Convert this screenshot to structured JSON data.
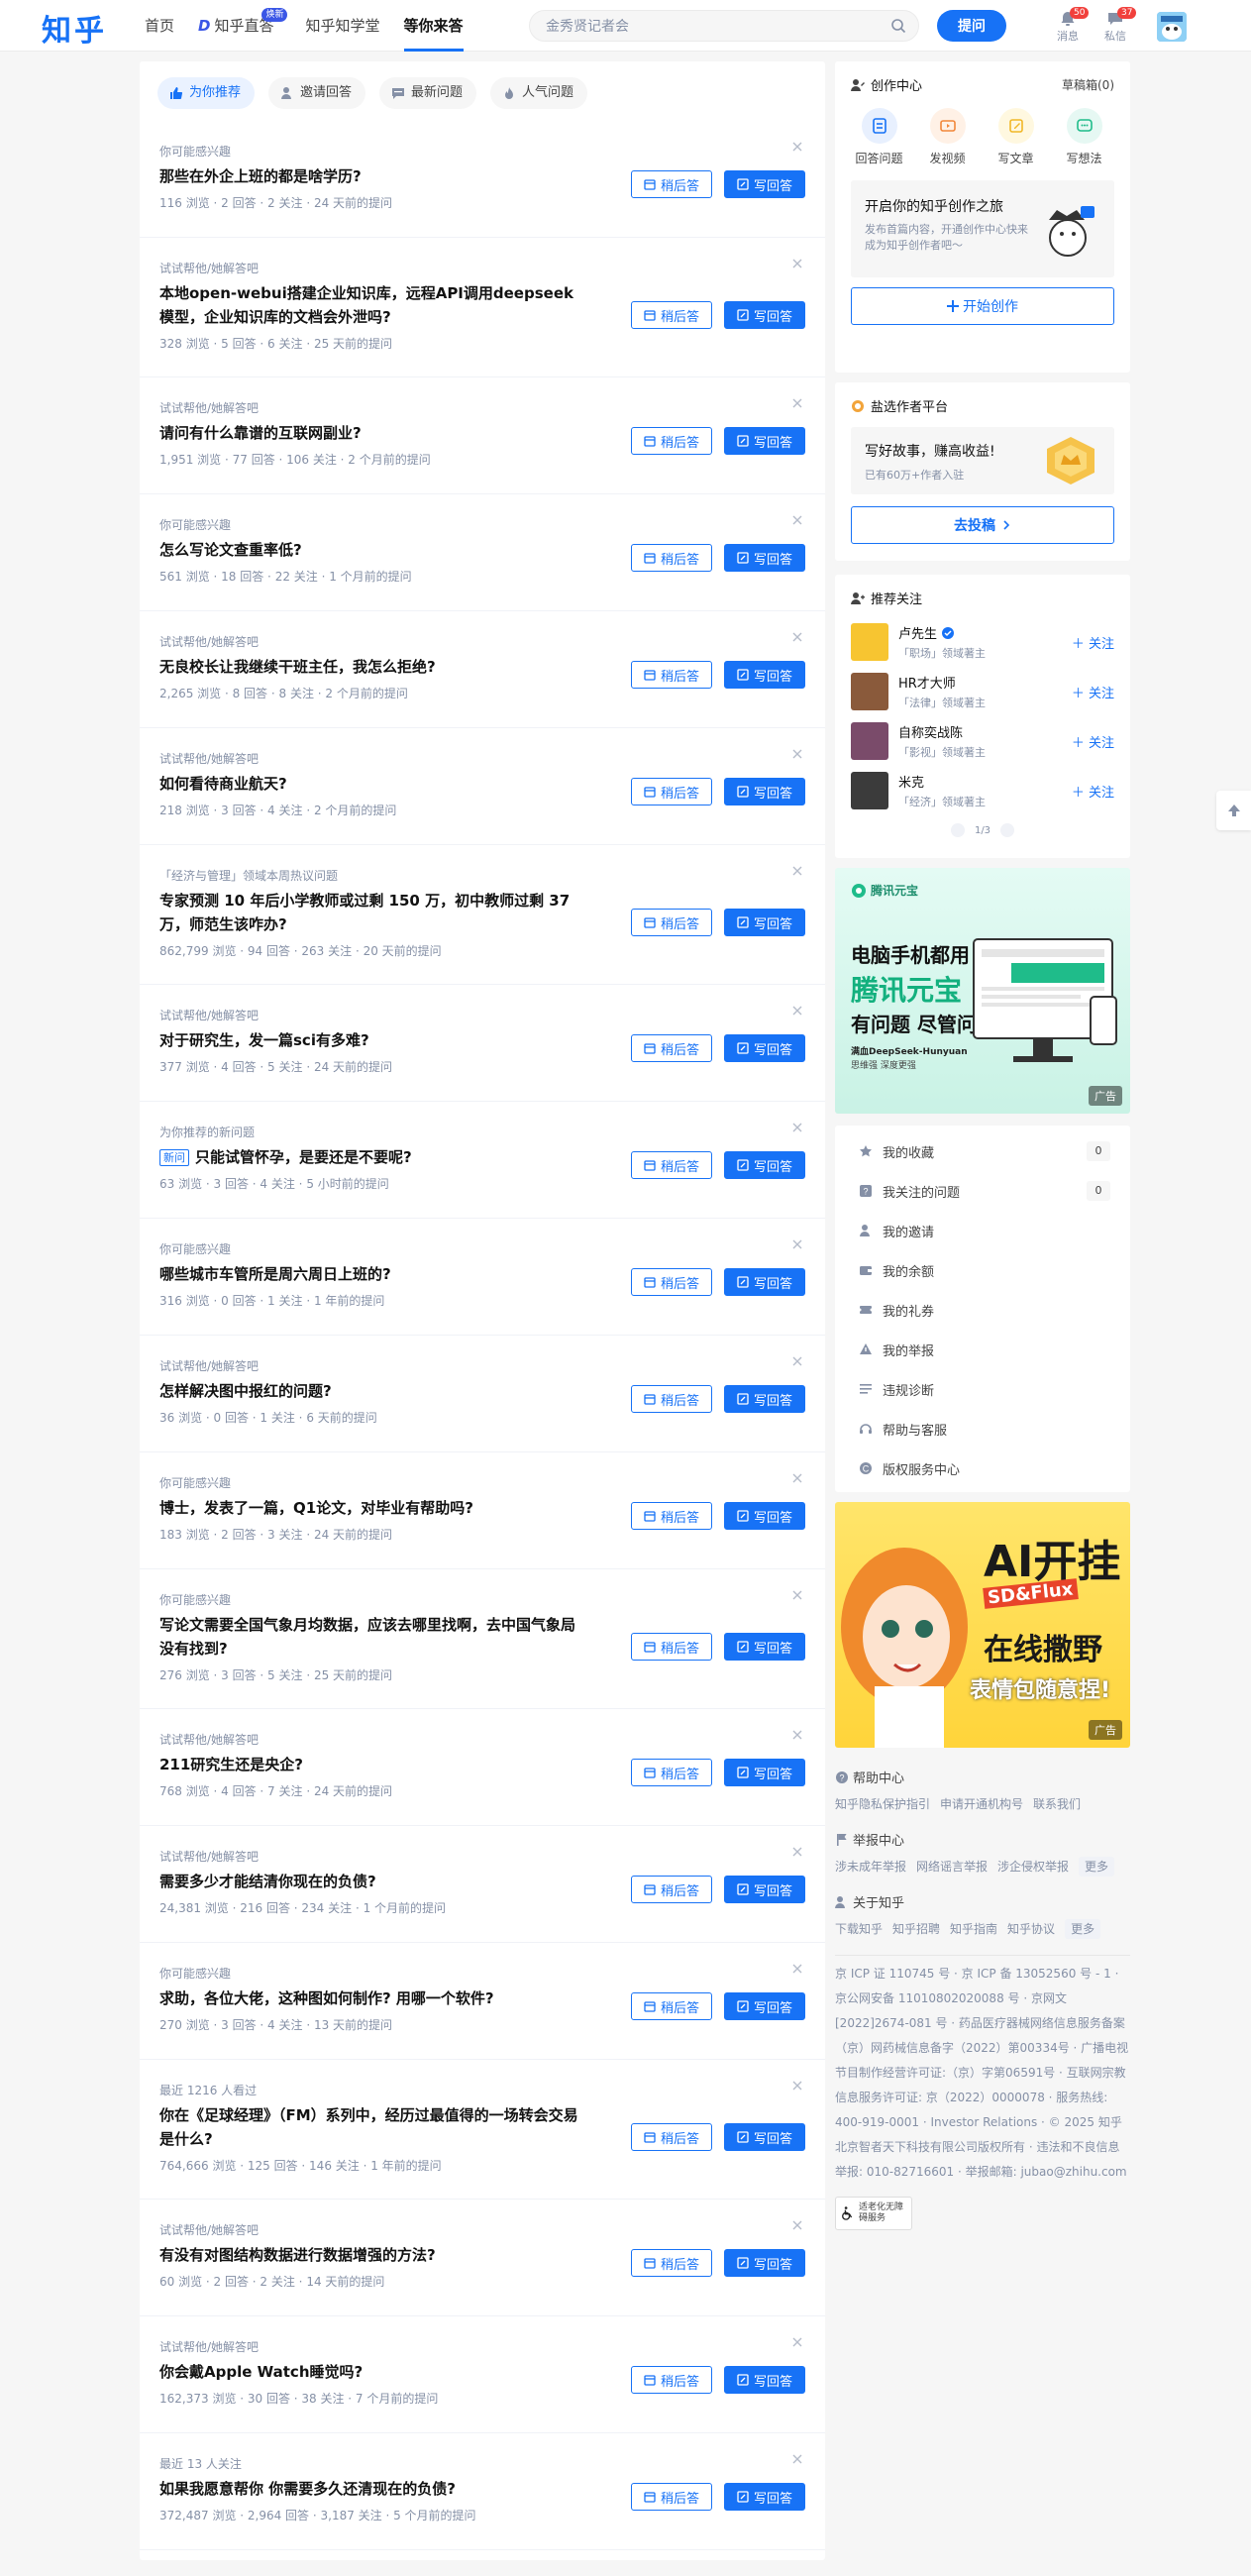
{
  "header": {
    "logo": "知乎",
    "nav": [
      {
        "label": "首页"
      },
      {
        "label": "知乎直答",
        "badge": "焕新"
      },
      {
        "label": "知乎知学堂"
      },
      {
        "label": "等你来答"
      }
    ],
    "search_placeholder": "金秀贤记者会",
    "ask_label": "提问",
    "messages_label": "消息",
    "messages_count": "50",
    "pm_label": "私信",
    "pm_count": "37"
  },
  "tabs": [
    {
      "label": "为你推荐"
    },
    {
      "label": "邀请回答"
    },
    {
      "label": "最新问题"
    },
    {
      "label": "人气问题"
    }
  ],
  "buttons": {
    "later": "稍后答",
    "write": "写回答"
  },
  "questions": [
    {
      "reason": "你可能感兴趣",
      "title": "那些在外企上班的都是啥学历?",
      "meta": "116 浏览 · 2 回答 · 2 关注 · 24 天前的提问"
    },
    {
      "reason": "试试帮他/她解答吧",
      "title": "本地open-webui搭建企业知识库，远程API调用deepseek模型，企业知识库的文档会外泄吗?",
      "meta": "328 浏览 · 5 回答 · 6 关注 · 25 天前的提问"
    },
    {
      "reason": "试试帮他/她解答吧",
      "title": "请问有什么靠谱的互联网副业?",
      "meta": "1,951 浏览 · 77 回答 · 106 关注 · 2 个月前的提问"
    },
    {
      "reason": "你可能感兴趣",
      "title": "怎么写论文查重率低?",
      "meta": "561 浏览 · 18 回答 · 22 关注 · 1 个月前的提问"
    },
    {
      "reason": "试试帮他/她解答吧",
      "title": "无良校长让我继续干班主任，我怎么拒绝?",
      "meta": "2,265 浏览 · 8 回答 · 8 关注 · 2 个月前的提问"
    },
    {
      "reason": "试试帮他/她解答吧",
      "title": "如何看待商业航天?",
      "meta": "218 浏览 · 3 回答 · 4 关注 · 2 个月前的提问"
    },
    {
      "reason": "「经济与管理」领域本周热议问题",
      "title": "专家预测 10 年后小学教师或过剩 150 万，初中教师过剩 37 万，师范生该咋办?",
      "meta": "862,799 浏览 · 94 回答 · 263 关注 · 20 天前的提问"
    },
    {
      "reason": "试试帮他/她解答吧",
      "title": "对于研究生，发一篇sci有多难?",
      "meta": "377 浏览 · 4 回答 · 5 关注 · 24 天前的提问"
    },
    {
      "reason": "为你推荐的新问题",
      "tag": "新问",
      "title": "只能试管怀孕，是要还是不要呢?",
      "meta": "63 浏览 · 3 回答 · 4 关注 · 5 小时前的提问"
    },
    {
      "reason": "你可能感兴趣",
      "title": "哪些城市车管所是周六周日上班的?",
      "meta": "316 浏览 · 0 回答 · 1 关注 · 1 年前的提问"
    },
    {
      "reason": "试试帮他/她解答吧",
      "title": "怎样解决图中报红的问题?",
      "meta": "36 浏览 · 0 回答 · 1 关注 · 6 天前的提问"
    },
    {
      "reason": "你可能感兴趣",
      "title": "博士，发表了一篇，Q1论文，对毕业有帮助吗?",
      "meta": "183 浏览 · 2 回答 · 3 关注 · 24 天前的提问"
    },
    {
      "reason": "你可能感兴趣",
      "title": "写论文需要全国气象月均数据，应该去哪里找啊，去中国气象局没有找到?",
      "meta": "276 浏览 · 3 回答 · 5 关注 · 25 天前的提问"
    },
    {
      "reason": "试试帮他/她解答吧",
      "title": "211研究生还是央企?",
      "meta": "768 浏览 · 4 回答 · 7 关注 · 24 天前的提问"
    },
    {
      "reason": "试试帮他/她解答吧",
      "title": "需要多少才能结清你现在的负债?",
      "meta": "24,381 浏览 · 216 回答 · 234 关注 · 1 个月前的提问"
    },
    {
      "reason": "你可能感兴趣",
      "title": "求助，各位大佬，这种图如何制作? 用哪一个软件?",
      "meta": "270 浏览 · 3 回答 · 4 关注 · 13 天前的提问"
    },
    {
      "reason": "最近 1216 人看过",
      "title": "你在《足球经理》（FM）系列中，经历过最值得的一场转会交易是什么?",
      "meta": "764,666 浏览 · 125 回答 · 146 关注 · 1 年前的提问"
    },
    {
      "reason": "试试帮他/她解答吧",
      "title": "有没有对图结构数据进行数据增强的方法?",
      "meta": "60 浏览 · 2 回答 · 2 关注 · 14 天前的提问"
    },
    {
      "reason": "试试帮他/她解答吧",
      "title": "你会戴Apple Watch睡觉吗?",
      "meta": "162,373 浏览 · 30 回答 · 38 关注 · 7 个月前的提问"
    },
    {
      "reason": "最近 13 人关注",
      "title": "如果我愿意帮你 你需要多久还清现在的负债?",
      "meta": "372,487 浏览 · 2,964 回答 · 3,187 关注 · 5 个月前的提问"
    }
  ],
  "creation": {
    "title": "创作中心",
    "drafts": "草稿箱(0)",
    "items": [
      {
        "label": "回答问题",
        "bg": "#e8f0fe",
        "fg": "#1772f6"
      },
      {
        "label": "发视频",
        "bg": "#fff1e6",
        "fg": "#f2873a"
      },
      {
        "label": "写文章",
        "bg": "#fff8e0",
        "fg": "#f1b728"
      },
      {
        "label": "写想法",
        "bg": "#e6f8f3",
        "fg": "#1fbc8a"
      }
    ],
    "promo_title": "开启你的知乎创作之旅",
    "promo_sub": "发布首篇内容，开通创作中心快来成为知乎创作者吧～",
    "start_label": "开始创作"
  },
  "yan": {
    "title": "盐选作者平台",
    "promo_title": "写好故事，赚高收益!",
    "promo_sub": "已有60万+作者入驻",
    "submit_label": "去投稿"
  },
  "recommend": {
    "title": "推荐关注",
    "follow_label": "关注",
    "users": [
      {
        "name": "卢先生",
        "desc": "「职场」领域著主",
        "color": "#f7c531"
      },
      {
        "name": "HR才大师",
        "desc": "「法律」领域著主",
        "color": "#8a5a3b"
      },
      {
        "name": "自称奕战陈",
        "desc": "「影视」领域著主",
        "color": "#7a4b6a"
      },
      {
        "name": "米克",
        "desc": "「经济」领域著主",
        "color": "#3b3b3b"
      }
    ],
    "pager": "1/3"
  },
  "ad1": {
    "brand": "腾讯元宝",
    "line1": "电脑手机都用",
    "line2": "腾讯元宝",
    "line3": "有问题 尽管问",
    "line4": "满血DeepSeek-Hunyuan",
    "line5": "思维强 深度更强",
    "label": "广告"
  },
  "menu": [
    {
      "label": "我的收藏",
      "count": "0",
      "icon": "star-icon"
    },
    {
      "label": "我关注的问题",
      "count": "0",
      "icon": "question-icon"
    },
    {
      "label": "我的邀请",
      "icon": "invite-icon"
    },
    {
      "label": "我的余额",
      "icon": "wallet-icon"
    },
    {
      "label": "我的礼券",
      "icon": "coupon-icon"
    },
    {
      "label": "我的举报",
      "icon": "warning-icon"
    },
    {
      "label": "违规诊断",
      "icon": "list-icon"
    },
    {
      "label": "帮助与客服",
      "icon": "headset-icon"
    },
    {
      "label": "版权服务中心",
      "icon": "copyright-icon"
    }
  ],
  "ad2": {
    "line1": "AI开挂",
    "line2": "SD&Flux",
    "line3": "在线撒野",
    "line4": "表情包随意捏!",
    "label": "广告"
  },
  "footer": {
    "help_title": "帮助中心",
    "help_links": [
      "知乎隐私保护指引",
      "申请开通机构号",
      "联系我们"
    ],
    "report_title": "举报中心",
    "report_links": [
      "涉未成年举报",
      "网络谣言举报",
      "涉企侵权举报",
      "更多"
    ],
    "about_title": "关于知乎",
    "about_links": [
      "下载知乎",
      "知乎招聘",
      "知乎指南",
      "知乎协议",
      "更多"
    ],
    "legal": "京 ICP 证 110745 号 · 京 ICP 备 13052560 号 - 1 · 京公网安备 11010802020088 号 · 京网文[2022]2674-081 号 · 药品医疗器械网络信息服务备案（京）网药械信息备字（2022）第00334号 · 广播电视节目制作经营许可证:（京）字第06591号 · 互联网宗教信息服务许可证: 京（2022）0000078 · 服务热线: 400-919-0001 · Investor Relations · © 2025 知乎 北京智者天下科技有限公司版权所有 · 违法和不良信息举报: 010-82716601 · 举报邮箱: jubao@zhihu.com",
    "aged_label": "适老化无障碍服务"
  }
}
